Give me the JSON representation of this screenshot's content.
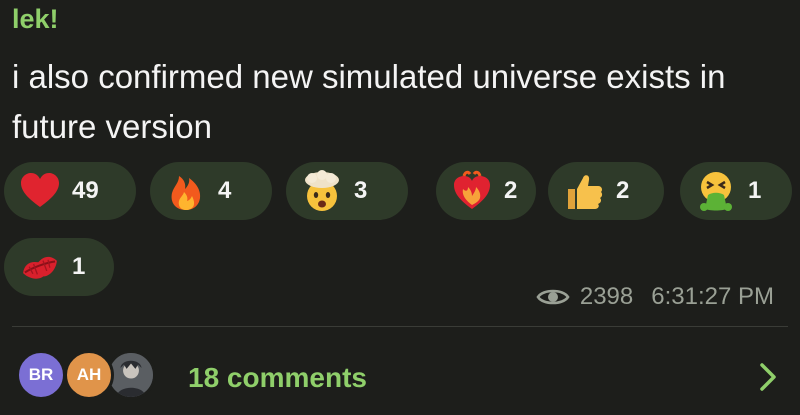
{
  "post": {
    "author": "lek!",
    "message": "i also confirmed new simulated universe exists in future version"
  },
  "reactions": [
    {
      "emoji": "red-heart-icon",
      "count": "49"
    },
    {
      "emoji": "fire-icon",
      "count": "4"
    },
    {
      "emoji": "exploding-head-icon",
      "count": "3"
    },
    {
      "emoji": "heart-on-fire-icon",
      "count": "2"
    },
    {
      "emoji": "thumbs-up-icon",
      "count": "2"
    },
    {
      "emoji": "vomiting-face-icon",
      "count": "1"
    },
    {
      "emoji": "kiss-mark-icon",
      "count": "1"
    }
  ],
  "meta": {
    "views": "2398",
    "time": "6:31:27 PM"
  },
  "comments": {
    "label": "18 comments",
    "avatars": [
      "BR",
      "AH",
      ""
    ]
  },
  "colors": {
    "accent": "#8fcf6a",
    "reaction_bg": "#2e3a29",
    "background": "#1d1e1b"
  }
}
